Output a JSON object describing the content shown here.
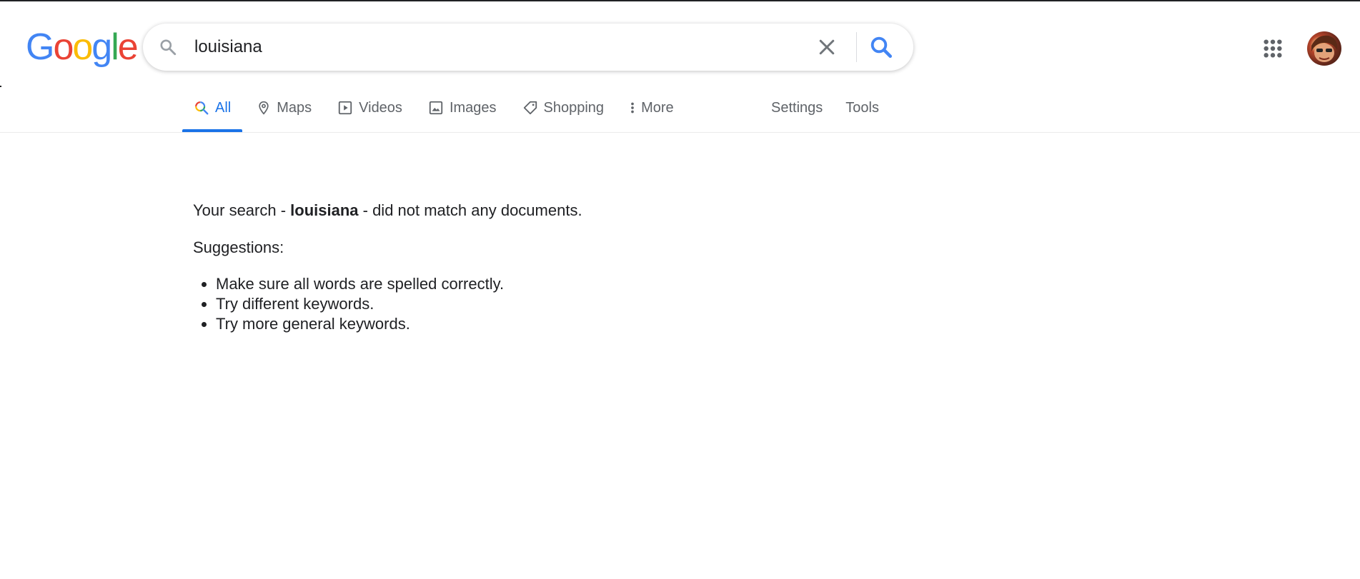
{
  "search": {
    "query": "louisiana",
    "logo_letters": [
      {
        "ch": "G",
        "color": "#4285F4"
      },
      {
        "ch": "o",
        "color": "#EA4335"
      },
      {
        "ch": "o",
        "color": "#FBBC05"
      },
      {
        "ch": "g",
        "color": "#4285F4"
      },
      {
        "ch": "l",
        "color": "#34A853"
      },
      {
        "ch": "e",
        "color": "#EA4335"
      }
    ]
  },
  "tabs": {
    "all": "All",
    "maps": "Maps",
    "videos": "Videos",
    "images": "Images",
    "shopping": "Shopping",
    "more": "More",
    "settings": "Settings",
    "tools": "Tools"
  },
  "results": {
    "no_match_prefix": "Your search - ",
    "no_match_query": "louisiana",
    "no_match_suffix": " - did not match any documents.",
    "suggestions_heading": "Suggestions:",
    "suggestions": [
      "Make sure all words are spelled correctly.",
      "Try different keywords.",
      "Try more general keywords."
    ]
  },
  "colors": {
    "accent": "#1a73e8",
    "text": "#202124",
    "muted": "#5f6368"
  }
}
